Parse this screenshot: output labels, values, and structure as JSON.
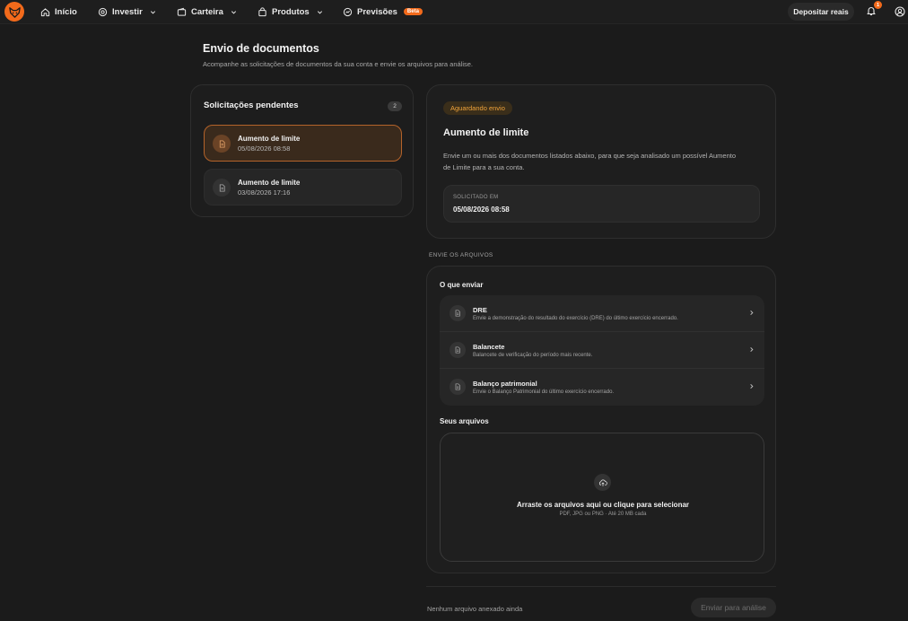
{
  "nav": {
    "items": [
      {
        "label": "Início"
      },
      {
        "label": "Investir"
      },
      {
        "label": "Carteira"
      },
      {
        "label": "Produtos"
      },
      {
        "label": "Previsões",
        "badge": "Beta"
      }
    ],
    "deposit_label": "Depositar reais",
    "notification_count": "1",
    "accent_color": "#f26a1b"
  },
  "page": {
    "title": "Envio de documentos",
    "subtitle": "Acompanhe as solicitações de documentos da sua conta e envie os arquivos para análise."
  },
  "pending": {
    "title": "Solicitações pendentes",
    "count": "2",
    "items": [
      {
        "name": "Aumento de limite",
        "date": "05/08/2026 08:58",
        "active": true
      },
      {
        "name": "Aumento de limite",
        "date": "03/08/2026 17:16",
        "active": false
      }
    ]
  },
  "detail": {
    "status": "Aguardando envio",
    "title": "Aumento de limite",
    "description": "Envie um ou mais dos documentos listados abaixo, para que seja analisado um possível Aumento de Limite para a sua conta.",
    "requested_label": "SOLICITADO EM",
    "requested_value": "05/08/2026 08:58"
  },
  "files": {
    "section_label": "ENVIE OS ARQUIVOS",
    "what_label": "O que enviar",
    "documents": [
      {
        "name": "DRE",
        "description": "Envie a demonstração do resultado do exercício (DRE) do último exercício encerrado."
      },
      {
        "name": "Balancete",
        "description": "Balancete de verificação do período mais recente."
      },
      {
        "name": "Balanço patrimonial",
        "description": "Envie o Balanço Patrimonial do último exercício encerrado."
      }
    ],
    "your_files_label": "Seus arquivos",
    "dropzone_title": "Arraste os arquivos aqui ou clique para selecionar",
    "dropzone_hint": "PDF, JPG ou PNG · Até 20 MB cada"
  },
  "footer": {
    "no_file": "Nenhum arquivo anexado ainda",
    "submit_label": "Enviar para análise"
  }
}
